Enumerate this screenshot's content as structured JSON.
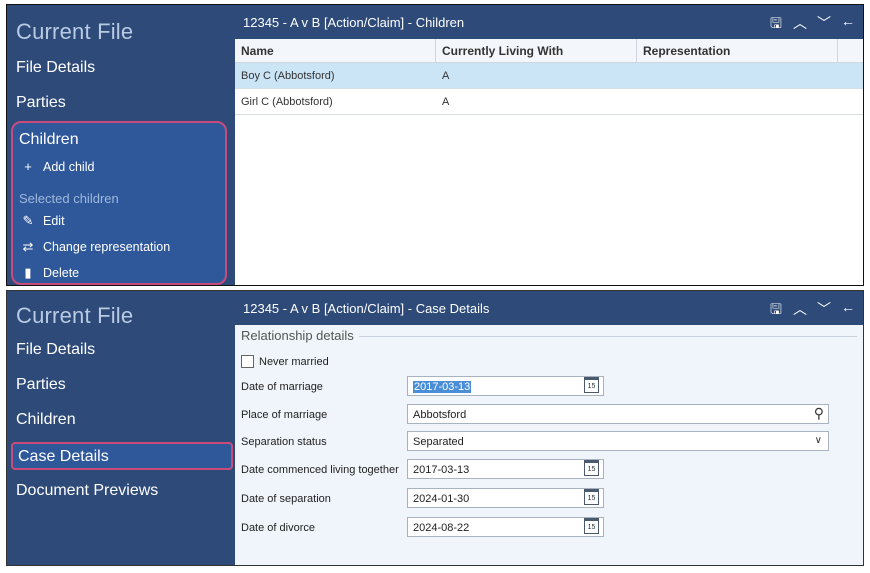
{
  "top": {
    "sidebar": {
      "title": "Current File",
      "items": [
        "File Details",
        "Parties"
      ],
      "children_section": {
        "title": "Children",
        "add_child": "Add child",
        "selected_label": "Selected children",
        "edit": "Edit",
        "change_representation": "Change representation",
        "delete": "Delete"
      }
    },
    "header": {
      "title": "12345 - A v B [Action/Claim] - Children"
    },
    "table": {
      "columns": [
        "Name",
        "Currently Living With",
        "Representation"
      ],
      "rows": [
        {
          "name": "Boy C (Abbotsford)",
          "living_with": "A",
          "representation": ""
        },
        {
          "name": "Girl C (Abbotsford)",
          "living_with": "A",
          "representation": ""
        }
      ]
    }
  },
  "bottom": {
    "sidebar": {
      "title": "Current File",
      "items": [
        "File Details",
        "Parties",
        "Children",
        "Case Details",
        "Document Previews"
      ]
    },
    "header": {
      "title": "12345 - A v B [Action/Claim] - Case Details"
    },
    "form": {
      "section_title": "Relationship details",
      "never_married_label": "Never married",
      "fields": {
        "date_of_marriage": {
          "label": "Date of marriage",
          "value": "2017-03-13"
        },
        "place_of_marriage": {
          "label": "Place of marriage",
          "value": "Abbotsford"
        },
        "separation_status": {
          "label": "Separation status",
          "value": "Separated"
        },
        "date_commenced": {
          "label": "Date commenced living together",
          "value": "2017-03-13"
        },
        "date_of_separation": {
          "label": "Date of separation",
          "value": "2024-01-30"
        },
        "date_of_divorce": {
          "label": "Date of divorce",
          "value": "2024-08-22"
        }
      },
      "calendar_day": "15"
    }
  },
  "icons": [
    "save-icon",
    "chevron-up-icon",
    "chevron-down-icon",
    "back-arrow-icon",
    "plus-icon",
    "pencil-icon",
    "swap-icon",
    "trash-icon",
    "calendar-icon",
    "search-icon",
    "dropdown-icon"
  ],
  "colors": {
    "navy": "#2d4a78",
    "highlight": "#c84b7b",
    "selected_row": "#cbe5f6"
  }
}
